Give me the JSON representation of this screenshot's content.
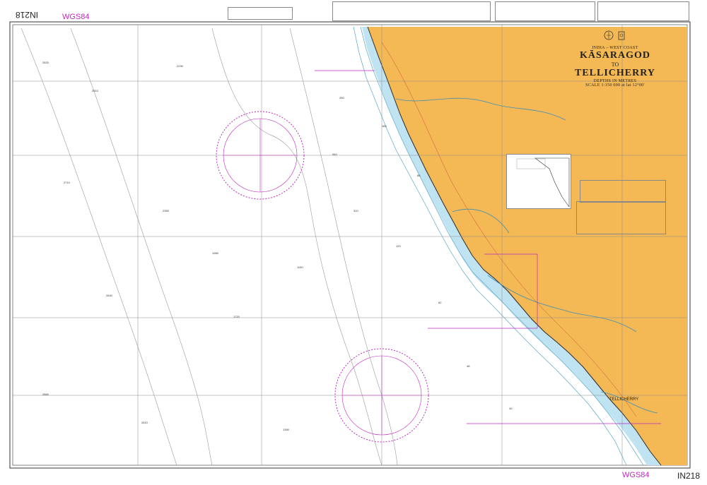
{
  "header": {
    "chart_number_top_left_rotated": "IN218",
    "datum_top": "WGS84",
    "datum_bottom": "WGS84",
    "chart_number_bottom_right": "IN218"
  },
  "title": {
    "region": "INDIA – WEST COAST",
    "name_line1": "KĀSARAGOD",
    "name_line2": "TO",
    "name_line3": "TELLICHERRY",
    "depths": "DEPTHS IN METRES",
    "scale": "SCALE 1:150 000 at lat 12°00'"
  },
  "places": {
    "tellicherry": "TELLICHERRY"
  },
  "colors": {
    "land": "#f4b955",
    "sea": "#ffffff",
    "shallow": "#bfe3f0",
    "magenta": "#c028c0",
    "grid": "#8c8c8c",
    "coast": "#2a2a2a"
  },
  "icons": {
    "emblem_1": "naval-crest-icon",
    "emblem_2": "national-emblem-icon",
    "compass_1": "compass-rose-icon",
    "compass_2": "compass-rose-icon"
  }
}
